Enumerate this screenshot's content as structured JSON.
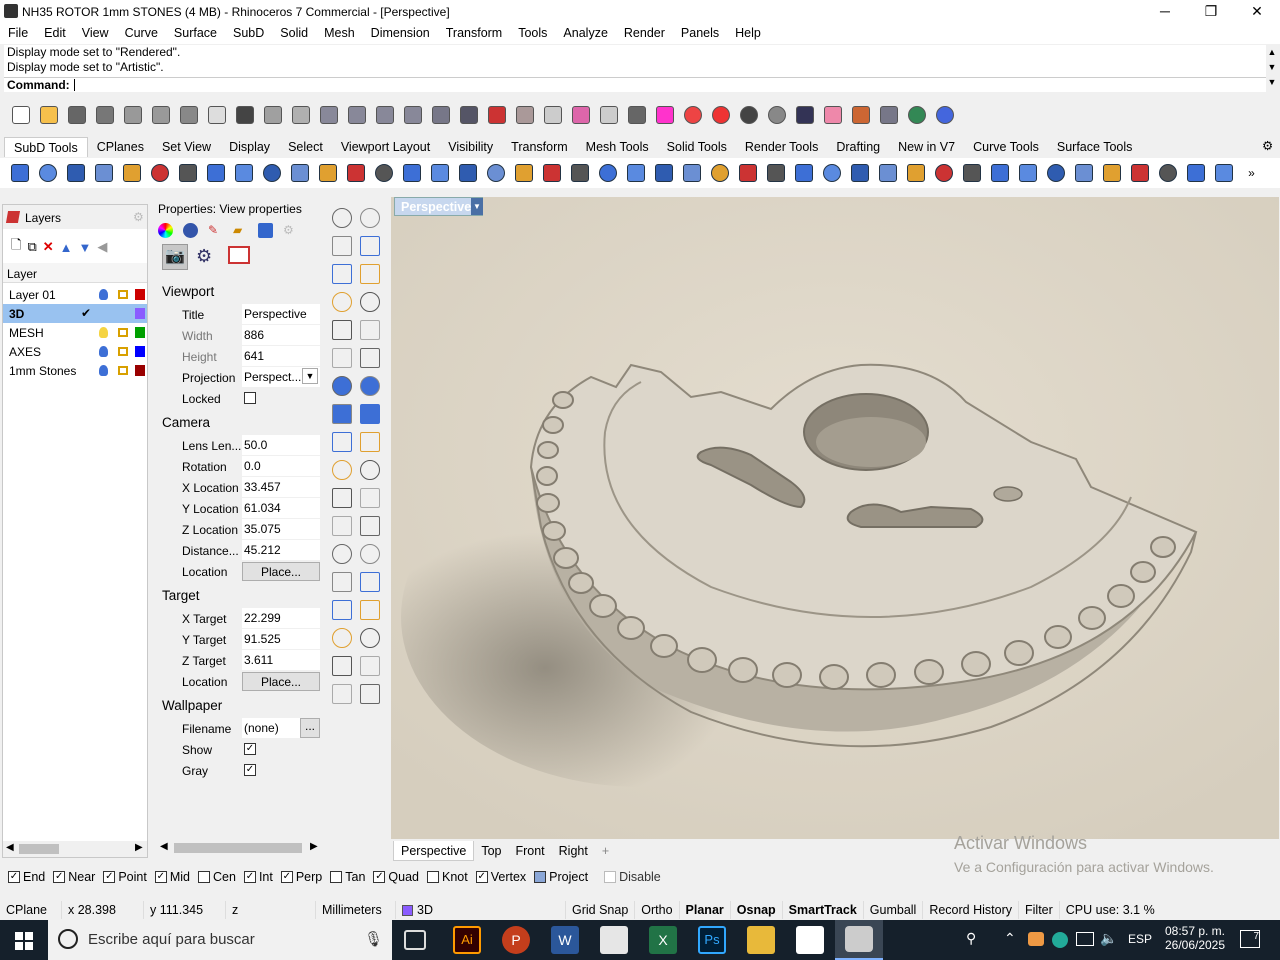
{
  "window": {
    "title": "NH35 ROTOR 1mm STONES (4 MB) - Rhinoceros 7 Commercial - [Perspective]",
    "minimize": "─",
    "restore": "❐",
    "close": "✕"
  },
  "menu": [
    "File",
    "Edit",
    "View",
    "Curve",
    "Surface",
    "SubD",
    "Solid",
    "Mesh",
    "Dimension",
    "Transform",
    "Tools",
    "Analyze",
    "Render",
    "Panels",
    "Help"
  ],
  "command": {
    "history": [
      "Display mode set to \"Rendered\".",
      "Display mode set to \"Artistic\"."
    ],
    "prompt": "Command:"
  },
  "toolbar_tabs": [
    "SubD Tools",
    "CPlanes",
    "Set View",
    "Display",
    "Select",
    "Viewport Layout",
    "Visibility",
    "Transform",
    "Mesh Tools",
    "Solid Tools",
    "Render Tools",
    "Drafting",
    "New in V7",
    "Curve Tools",
    "Surface Tools"
  ],
  "layers_panel": {
    "tab": "Layers",
    "header": "Layer",
    "rows": [
      {
        "name": "Layer 01",
        "color": "#cc0000",
        "current": false
      },
      {
        "name": "3D",
        "color": "#8a5cff",
        "current": true
      },
      {
        "name": "MESH",
        "color": "#00a000",
        "current": false
      },
      {
        "name": "AXES",
        "color": "#0000ff",
        "current": false
      },
      {
        "name": "1mm Stones",
        "color": "#990000",
        "current": false
      }
    ]
  },
  "properties": {
    "tab": "Properties: View properties",
    "viewport_section": "Viewport",
    "title_label": "Title",
    "title_value": "Perspective",
    "width_label": "Width",
    "width_value": "886",
    "height_label": "Height",
    "height_value": "641",
    "projection_label": "Projection",
    "projection_value": "Perspect...",
    "locked_label": "Locked",
    "camera_section": "Camera",
    "lens_label": "Lens Len...",
    "lens_value": "50.0",
    "rotation_label": "Rotation",
    "rotation_value": "0.0",
    "xloc_label": "X Location",
    "xloc_value": "33.457",
    "yloc_label": "Y Location",
    "yloc_value": "61.034",
    "zloc_label": "Z Location",
    "zloc_value": "35.075",
    "dist_label": "Distance...",
    "dist_value": "45.212",
    "location_label": "Location",
    "place_button": "Place...",
    "target_section": "Target",
    "xt_label": "X Target",
    "xt_value": "22.299",
    "yt_label": "Y Target",
    "yt_value": "91.525",
    "zt_label": "Z Target",
    "zt_value": "3.611",
    "tloc_label": "Location",
    "tplace_button": "Place...",
    "wallpaper_section": "Wallpaper",
    "filename_label": "Filename",
    "filename_value": "(none)",
    "browse_button": "...",
    "show_label": "Show",
    "gray_label": "Gray"
  },
  "viewport": {
    "label": "Perspective",
    "watermark_title": "Activar Windows",
    "watermark_sub": "Ve a Configuración para activar Windows."
  },
  "view_tabs": [
    "Perspective",
    "Top",
    "Front",
    "Right",
    "+"
  ],
  "osnaps": [
    {
      "label": "End",
      "checked": true
    },
    {
      "label": "Near",
      "checked": true
    },
    {
      "label": "Point",
      "checked": true
    },
    {
      "label": "Mid",
      "checked": true
    },
    {
      "label": "Cen",
      "checked": false
    },
    {
      "label": "Int",
      "checked": true
    },
    {
      "label": "Perp",
      "checked": true
    },
    {
      "label": "Tan",
      "checked": false
    },
    {
      "label": "Quad",
      "checked": true
    },
    {
      "label": "Knot",
      "checked": false
    },
    {
      "label": "Vertex",
      "checked": true
    },
    {
      "label": "Project",
      "checked": false
    },
    {
      "label": "Disable",
      "checked": false
    }
  ],
  "status": {
    "cplane": "CPlane",
    "x": "x 28.398",
    "y": "y 111.345",
    "z": "z",
    "units": "Millimeters",
    "layer": "3D",
    "items": [
      "Grid Snap",
      "Ortho",
      "Planar",
      "Osnap",
      "SmartTrack",
      "Gumball",
      "Record History",
      "Filter"
    ],
    "cpu": "CPU use: 3.1 %"
  },
  "taskbar": {
    "search_placeholder": "Escribe aquí para buscar",
    "lang": "ESP",
    "time": "08:57 p. m.",
    "date": "26/06/2025",
    "notif": "7"
  }
}
